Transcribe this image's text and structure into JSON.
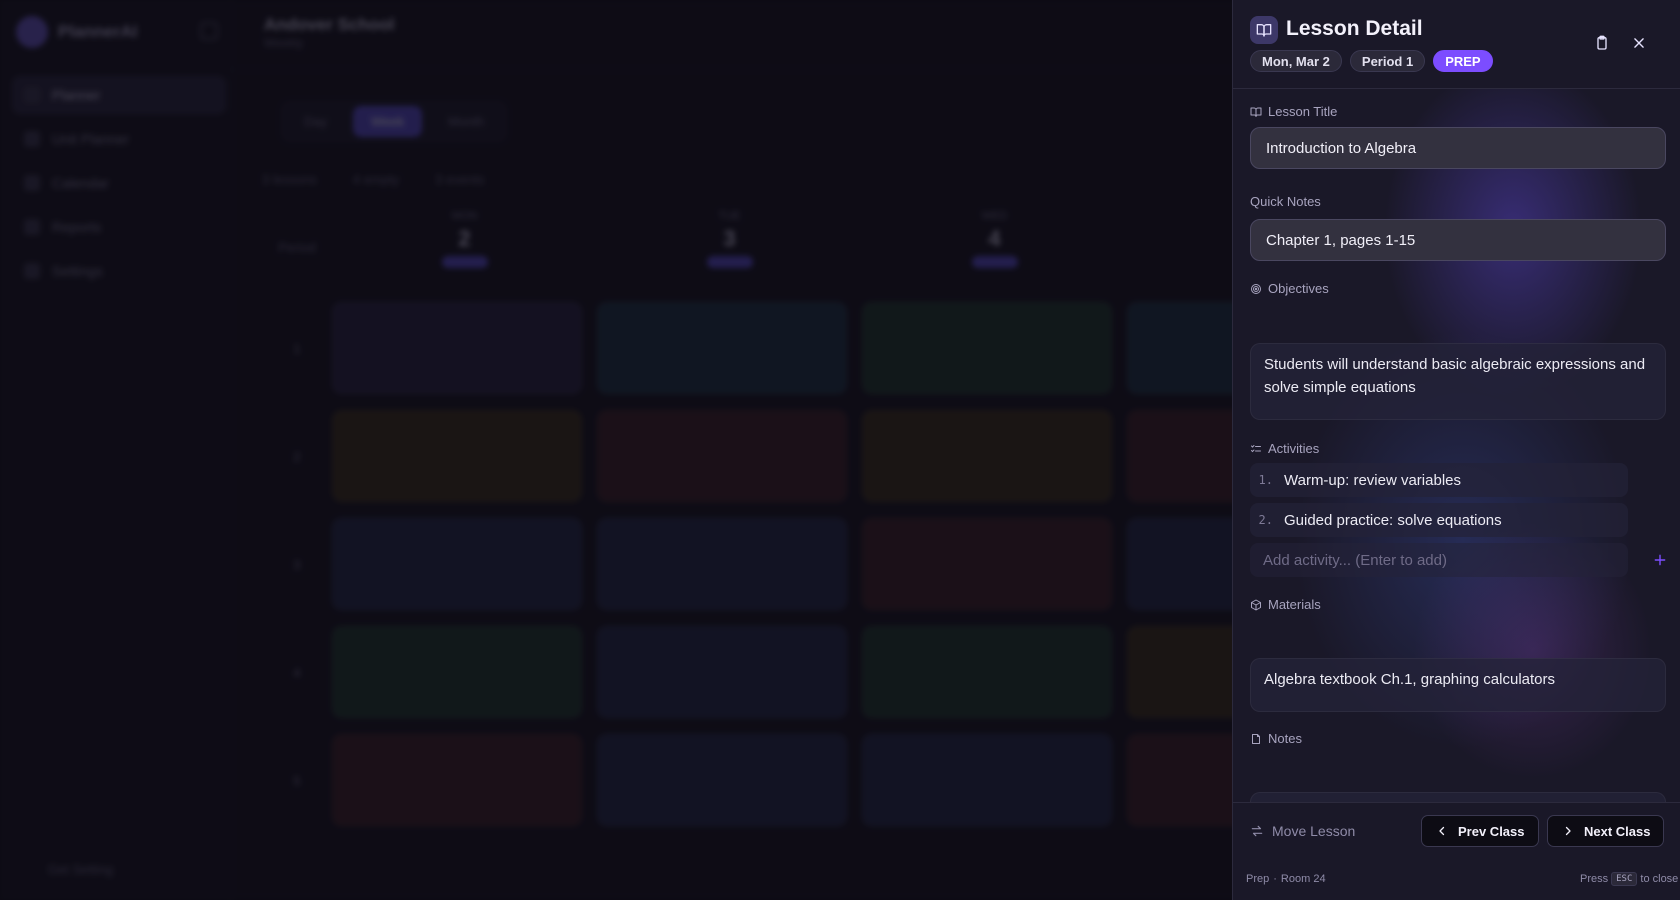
{
  "background": {
    "brand": "PlannerAI",
    "school": "Andover School",
    "subtitle": "Weekly",
    "nav": [
      "Planner",
      "Unit Planner",
      "Calendar",
      "Reports",
      "Settings"
    ],
    "footer": "Get Setting",
    "views": [
      "Day",
      "Week",
      "Month"
    ],
    "stats": [
      "3 lessons",
      "4 empty",
      "3 events"
    ],
    "period_header": "Period",
    "days": [
      {
        "name": "MON",
        "num": "2"
      },
      {
        "name": "TUE",
        "num": "3"
      },
      {
        "name": "WED",
        "num": "4"
      }
    ],
    "rows": [
      "1",
      "2",
      "3",
      "4",
      "5"
    ]
  },
  "panel": {
    "title": "Lesson Detail",
    "chips": {
      "date": "Mon, Mar 2",
      "period": "Period 1",
      "type": "PREP"
    },
    "fields": {
      "lesson_title_label": "Lesson Title",
      "lesson_title_value": "Introduction to Algebra",
      "quick_notes_label": "Quick Notes",
      "quick_notes_value": "Chapter 1, pages 1-15",
      "objectives_label": "Objectives",
      "objectives_value": "Students will understand basic algebraic expressions and solve simple equations",
      "activities_label": "Activities",
      "activities": [
        {
          "num": "1.",
          "text": "Warm-up: review variables"
        },
        {
          "num": "2.",
          "text": "Guided practice: solve equations"
        }
      ],
      "add_activity_placeholder": "Add activity... (Enter to add)",
      "materials_label": "Materials",
      "materials_value": "Algebra textbook Ch.1, graphing calculators",
      "notes_label": "Notes"
    },
    "footer": {
      "move_label": "Move Lesson",
      "prev_label": "Prev Class",
      "next_label": "Next Class"
    },
    "status": {
      "type": "Prep",
      "sep": "·",
      "room": "Room 24",
      "press": "Press",
      "key": "ESC",
      "to_close": "to close"
    }
  }
}
